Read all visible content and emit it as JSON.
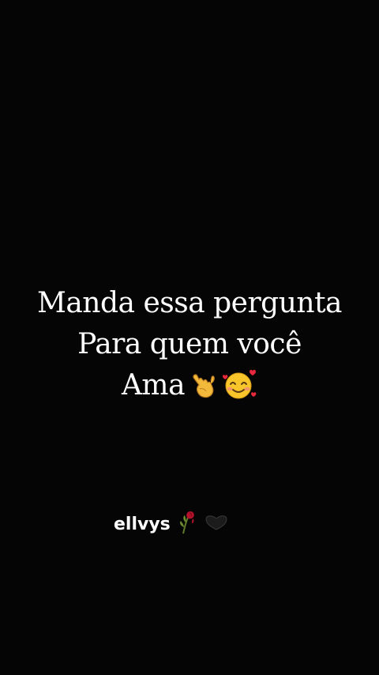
{
  "message": {
    "line1": "Manda essa pergunta",
    "line2": "Para quem você",
    "line3": "Ama"
  },
  "emojis": [
    "call-me-hand-icon",
    "smiling-face-with-hearts-icon"
  ],
  "watermark": {
    "username": "ellvys",
    "icons": [
      "wilted-rose-icon",
      "black-heart-icon"
    ]
  },
  "colors": {
    "background": "#050505",
    "text": "#ffffff"
  }
}
